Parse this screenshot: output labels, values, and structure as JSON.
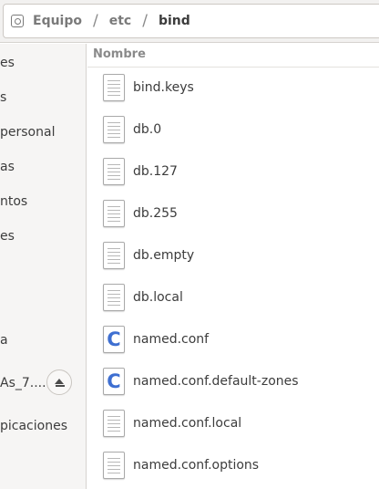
{
  "path": {
    "crumbs": [
      "Equipo",
      "etc",
      "bind"
    ],
    "separator": "/"
  },
  "sidebar": {
    "items": [
      {
        "label": "es"
      },
      {
        "label": "s"
      },
      {
        "label": "personal"
      },
      {
        "label": "as"
      },
      {
        "label": "ntos"
      },
      {
        "label": "es"
      },
      {
        "label": "a"
      },
      {
        "label": "As_7...."
      },
      {
        "label": "picaciones"
      }
    ]
  },
  "list": {
    "column_header": "Nombre",
    "files": [
      {
        "name": "bind.keys",
        "icon": "text-file-icon"
      },
      {
        "name": "db.0",
        "icon": "text-file-icon"
      },
      {
        "name": "db.127",
        "icon": "text-file-icon"
      },
      {
        "name": "db.255",
        "icon": "text-file-icon"
      },
      {
        "name": "db.empty",
        "icon": "text-file-icon"
      },
      {
        "name": "db.local",
        "icon": "text-file-icon"
      },
      {
        "name": "named.conf",
        "icon": "c-source-file-icon",
        "glyph": "C"
      },
      {
        "name": "named.conf.default-zones",
        "icon": "c-source-file-icon",
        "glyph": "C"
      },
      {
        "name": "named.conf.local",
        "icon": "text-file-icon"
      },
      {
        "name": "named.conf.options",
        "icon": "text-file-icon"
      }
    ]
  },
  "colors": {
    "accent_c_icon": "#3e6fd1",
    "sidebar_bg": "#f6f5f4",
    "header_bg": "#f2f1f0"
  }
}
